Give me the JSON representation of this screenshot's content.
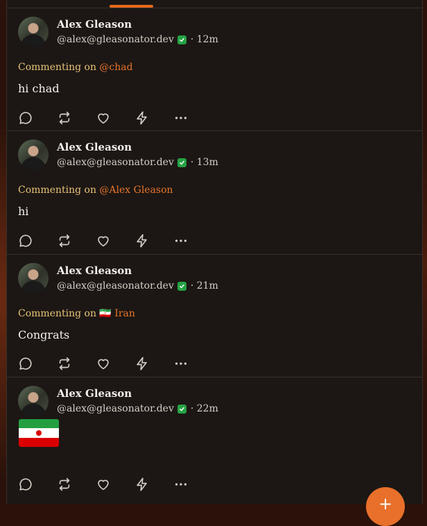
{
  "posts": [
    {
      "author": "Alex Gleason",
      "handle": "@alex@gleasonator.dev",
      "time": "· 12m",
      "replying_prefix": "Commenting on ",
      "replying_target": "@chad",
      "text": "hi chad"
    },
    {
      "author": "Alex Gleason",
      "handle": "@alex@gleasonator.dev",
      "time": "· 13m",
      "replying_prefix": "Commenting on ",
      "replying_target": "@Alex Gleason",
      "text": "hi"
    },
    {
      "author": "Alex Gleason",
      "handle": "@alex@gleasonator.dev",
      "time": "· 21m",
      "replying_prefix": "Commenting on ",
      "replying_flag": "🇮🇷",
      "replying_target": "Iran",
      "text": "Congrats"
    },
    {
      "author": "Alex Gleason",
      "handle": "@alex@gleasonator.dev",
      "time": "· 22m",
      "content_emoji": "iran-flag"
    }
  ],
  "icons": {
    "reply": "speech-bubble-icon",
    "repost": "repost-icon",
    "like": "heart-icon",
    "zap": "lightning-icon",
    "more": "more-dots-icon",
    "verified": "verified-badge-icon"
  },
  "colors": {
    "accent": "#e8702a",
    "mention": "#e8752a",
    "replying": "#e9c27a",
    "verified": "#25a244",
    "background": "#1c1714"
  },
  "fab": {
    "label": "+"
  }
}
